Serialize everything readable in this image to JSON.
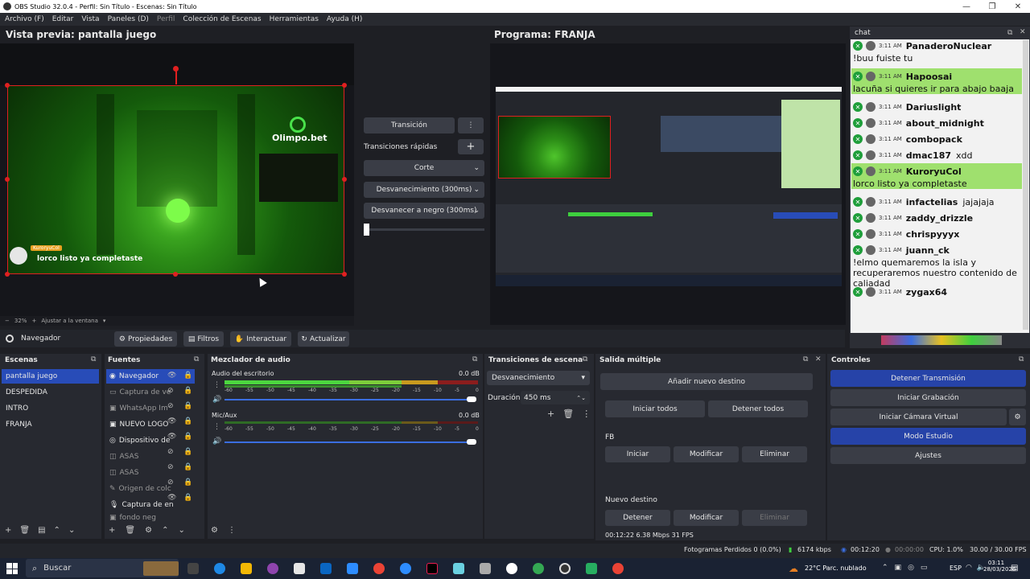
{
  "window": {
    "title": "OBS Studio 32.0.4 - Perfil: Sin Título - Escenas: Sin Título"
  },
  "menu": [
    "Archivo (F)",
    "Editar",
    "Vista",
    "Paneles (D)",
    "Perfil",
    "Colección de Escenas",
    "Herramientas",
    "Ayuda (H)"
  ],
  "preview": {
    "title": "Vista previa: pantalla juego",
    "overlay_user": "KuroryuCol",
    "overlay_msg": "lorco listo ya completaste",
    "brand": "Olimpo.bet",
    "zoom": "32%",
    "fit": "Ajustar a la ventana"
  },
  "program": {
    "title": "Programa: FRANJA"
  },
  "transitions": {
    "transition_btn": "Transición",
    "quick_label": "Transiciones rápidas",
    "cut": "Corte",
    "fade": "Desvanecimiento (300ms)",
    "fade_black": "Desvanecer a negro (300ms)"
  },
  "source_toolbar": {
    "current": "Navegador",
    "properties": "Propiedades",
    "filters": "Filtros",
    "interact": "Interactuar",
    "refresh": "Actualizar"
  },
  "scenes": {
    "title": "Escenas",
    "items": [
      "pantalla juego",
      "DESPEDIDA",
      "INTRO",
      "FRANJA"
    ]
  },
  "sources": {
    "title": "Fuentes",
    "items": [
      "Navegador",
      "Captura de ve",
      "WhatsApp Im",
      "NUEVO LOGO",
      "Dispositivo de",
      "ASAS",
      "ASAS",
      "Origen de colc",
      "Captura de en",
      "fondo neg"
    ]
  },
  "mixer": {
    "title": "Mezclador de audio",
    "ch1": "Audio del escritorio",
    "ch1_db": "0.0 dB",
    "ch2": "Mic/Aux",
    "ch2_db": "0.0 dB",
    "ticks": [
      "-60",
      "-55",
      "-50",
      "-45",
      "-40",
      "-35",
      "-30",
      "-25",
      "-20",
      "-15",
      "-10",
      "-5",
      "0"
    ]
  },
  "scene_transitions": {
    "title": "Transiciones de escena",
    "selected": "Desvanecimiento",
    "duration_label": "Duración",
    "duration": "450 ms"
  },
  "multi_output": {
    "title": "Salida múltiple",
    "add": "Añadir nuevo destino",
    "start_all": "Iniciar todos",
    "stop_all": "Detener todos",
    "dest1": "FB",
    "dest1_start": "Iniciar",
    "dest1_modify": "Modificar",
    "dest1_delete": "Eliminar",
    "dest2": "Nuevo destino",
    "dest2_stop": "Detener",
    "dest2_modify": "Modificar",
    "dest2_delete": "Eliminar",
    "status": "00:12:22  6.38 Mbps  31 FPS"
  },
  "controls": {
    "title": "Controles",
    "stop_stream": "Detener Transmisión",
    "start_rec": "Iniciar Grabación",
    "virtual_cam": "Iniciar Cámara Virtual",
    "studio_mode": "Modo Estudio",
    "settings": "Ajustes"
  },
  "chat": {
    "title": "chat",
    "rows": [
      {
        "time": "3:11 AM",
        "user": "PanaderoNuclear",
        "msg": "!buu fuiste tu",
        "hl": false
      },
      {
        "time": "3:11 AM",
        "user": "Hapoosai",
        "msg": "lacuña si quieres ir para abajo baaja",
        "hl": true
      },
      {
        "time": "3:11 AM",
        "user": "Dariuslight",
        "msg": "",
        "hl": false
      },
      {
        "time": "3:11 AM",
        "user": "about_midnight",
        "msg": "",
        "hl": false
      },
      {
        "time": "3:11 AM",
        "user": "combopack",
        "msg": "",
        "hl": false
      },
      {
        "time": "3:11 AM",
        "user": "dmac187",
        "msg": "xdd",
        "hl": false
      },
      {
        "time": "3:11 AM",
        "user": "KuroryuCol",
        "msg": "lorco listo ya completaste",
        "hl": true
      },
      {
        "time": "3:11 AM",
        "user": "infactelias",
        "msg": "jajajaja",
        "hl": false
      },
      {
        "time": "3:11 AM",
        "user": "zaddy_drizzle",
        "msg": "",
        "hl": false
      },
      {
        "time": "3:11 AM",
        "user": "chrispyyyx",
        "msg": "",
        "hl": false
      },
      {
        "time": "3:11 AM",
        "user": "juann_ck",
        "msg": "!elmo quemaremos la isla y recuperaremos nuestro contenido de caliadad",
        "hl": false
      },
      {
        "time": "3:11 AM",
        "user": "zygax64",
        "msg": "",
        "hl": false
      }
    ]
  },
  "statusbar": {
    "dropped": "Fotogramas Perdidos 0 (0.0%)",
    "kbps": "6174 kbps",
    "stream_time": "00:12:20",
    "rec_time": "00:00:00",
    "cpu": "CPU: 1.0%",
    "fps": "30.00 / 30.00 FPS"
  },
  "taskbar": {
    "search": "Buscar",
    "weather": "22°C  Parc. nublado",
    "lang": "ESP",
    "time": "03:11",
    "date": "28/03/2026"
  }
}
